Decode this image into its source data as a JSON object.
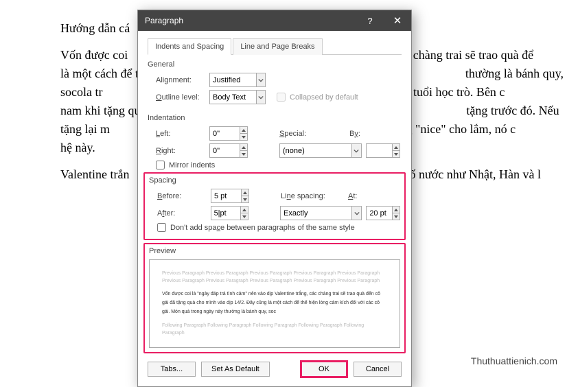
{
  "background": {
    "p1": "Hướng dẫn cá",
    "p2": "Vốn được coi                                                                                      các chàng trai sẽ trao quà để                                                                                     là một cách để thể hiện lòng                                                                                      thường là bánh quy, socola tr                                                                                     khiết của tuổi học trò. Bên c                                                                                     nam khi tặng quà đáp trả phả                                                                                     tặng trước đó. Nếu tặng lại m                                                                                    là không \"nice\" cho lắm, nó c                                                                                     hệ này.",
    "p3": "Valentine trắn                                                                                     ột số nước như Nhật, Hàn và l"
  },
  "dialog": {
    "title": "Paragraph",
    "tabs": {
      "t0": "Indents and Spacing",
      "t1": "Line and Page Breaks"
    },
    "general": {
      "title": "General",
      "alignment_lbl": "Alignment:",
      "alignment_val": "Justified",
      "outline_lbl": "Outline level:",
      "outline_val": "Body Text",
      "collapsed": "Collapsed by default"
    },
    "indent": {
      "title": "Indentation",
      "left_lbl": "Left:",
      "left_val": "0\"",
      "right_lbl": "Right:",
      "right_val": "0\"",
      "special_lbl": "Special:",
      "special_val": "(none)",
      "by_lbl": "By:",
      "by_val": "",
      "mirror": "Mirror indents"
    },
    "spacing": {
      "title": "Spacing",
      "before_lbl": "Before:",
      "before_val": "5 pt",
      "after_lbl": "After:",
      "after_val": "5 pt",
      "line_lbl": "Line spacing:",
      "line_val": "Exactly",
      "at_lbl": "At:",
      "at_val": "20 pt",
      "nospace": "Don't add space between paragraphs of the same style"
    },
    "preview": {
      "title": "Preview",
      "prev": "Previous Paragraph Previous Paragraph Previous Paragraph Previous Paragraph Previous Paragraph Previous Paragraph Previous Paragraph Previous Paragraph Previous Paragraph Previous Paragraph",
      "sample": "Vốn được coi là \"ngày đáp trả tình cảm\" nên vào dịp Valentine trắng, các chàng trai sẽ trao quà đến cô gái đã tặng quà cho mình vào dịp 14/2. Đây cũng là một cách để thể hiện lòng cảm kích đối với các cô gái. Món quà trong ngày này thường là bánh quy, soc",
      "foll": "Following Paragraph Following Paragraph Following Paragraph Following Paragraph Following Paragraph"
    },
    "buttons": {
      "tabs": "Tabs...",
      "default": "Set As Default",
      "ok": "OK",
      "cancel": "Cancel"
    }
  },
  "watermark": "Thuthuattienich.com"
}
